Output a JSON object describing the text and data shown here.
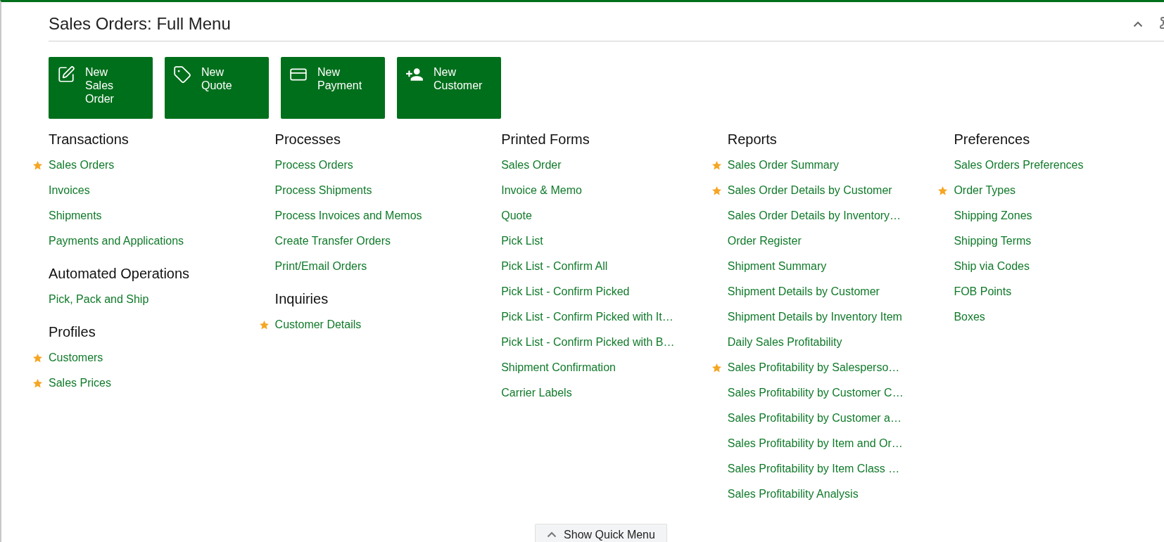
{
  "header": {
    "title": "Sales Orders: Full Menu"
  },
  "quick_actions": [
    {
      "kind": "edit",
      "label": "New Sales Order"
    },
    {
      "kind": "tag",
      "label": "New Quote"
    },
    {
      "kind": "card",
      "label": "New Payment"
    },
    {
      "kind": "person",
      "label": "New Customer"
    }
  ],
  "columns": [
    {
      "sections": [
        {
          "heading": "Transactions",
          "items": [
            {
              "label": "Sales Orders",
              "starred": true
            },
            {
              "label": "Invoices",
              "starred": false
            },
            {
              "label": "Shipments",
              "starred": false
            },
            {
              "label": "Payments and Applications",
              "starred": false
            }
          ]
        },
        {
          "heading": "Automated Operations",
          "items": [
            {
              "label": "Pick, Pack and Ship",
              "starred": false
            }
          ]
        },
        {
          "heading": "Profiles",
          "items": [
            {
              "label": "Customers",
              "starred": true
            },
            {
              "label": "Sales Prices",
              "starred": true
            }
          ]
        }
      ]
    },
    {
      "sections": [
        {
          "heading": "Processes",
          "items": [
            {
              "label": "Process Orders",
              "starred": false
            },
            {
              "label": "Process Shipments",
              "starred": false
            },
            {
              "label": "Process Invoices and Memos",
              "starred": false
            },
            {
              "label": "Create Transfer Orders",
              "starred": false
            },
            {
              "label": "Print/Email Orders",
              "starred": false
            }
          ]
        },
        {
          "heading": "Inquiries",
          "items": [
            {
              "label": "Customer Details",
              "starred": true
            }
          ]
        }
      ]
    },
    {
      "sections": [
        {
          "heading": "Printed Forms",
          "items": [
            {
              "label": "Sales Order",
              "starred": false
            },
            {
              "label": "Invoice & Memo",
              "starred": false
            },
            {
              "label": "Quote",
              "starred": false
            },
            {
              "label": "Pick List",
              "starred": false
            },
            {
              "label": "Pick List - Confirm All",
              "starred": false
            },
            {
              "label": "Pick List - Confirm Picked",
              "starred": false
            },
            {
              "label": "Pick List - Confirm Picked with It…",
              "starred": false
            },
            {
              "label": "Pick List - Confirm Picked with B…",
              "starred": false
            },
            {
              "label": "Shipment Confirmation",
              "starred": false
            },
            {
              "label": "Carrier Labels",
              "starred": false
            }
          ]
        }
      ]
    },
    {
      "sections": [
        {
          "heading": "Reports",
          "items": [
            {
              "label": "Sales Order Summary",
              "starred": true
            },
            {
              "label": "Sales Order Details by Customer",
              "starred": true
            },
            {
              "label": "Sales Order Details by Inventory…",
              "starred": false
            },
            {
              "label": "Order Register",
              "starred": false
            },
            {
              "label": "Shipment Summary",
              "starred": false
            },
            {
              "label": "Shipment Details by Customer",
              "starred": false
            },
            {
              "label": "Shipment Details by Inventory Item",
              "starred": false
            },
            {
              "label": "Daily Sales Profitability",
              "starred": false
            },
            {
              "label": "Sales Profitability by Salesperso…",
              "starred": true
            },
            {
              "label": "Sales Profitability by Customer C…",
              "starred": false
            },
            {
              "label": "Sales Profitability by Customer a…",
              "starred": false
            },
            {
              "label": "Sales Profitability by Item and Or…",
              "starred": false
            },
            {
              "label": "Sales Profitability by Item Class …",
              "starred": false
            },
            {
              "label": "Sales Profitability Analysis",
              "starred": false
            }
          ]
        }
      ]
    },
    {
      "sections": [
        {
          "heading": "Preferences",
          "items": [
            {
              "label": "Sales Orders Preferences",
              "starred": false
            },
            {
              "label": "Order Types",
              "starred": true
            },
            {
              "label": "Shipping Zones",
              "starred": false
            },
            {
              "label": "Shipping Terms",
              "starred": false
            },
            {
              "label": "Ship via Codes",
              "starred": false
            },
            {
              "label": "FOB Points",
              "starred": false
            },
            {
              "label": "Boxes",
              "starred": false
            }
          ]
        }
      ]
    }
  ],
  "footer": {
    "button": "Show Quick Menu"
  }
}
